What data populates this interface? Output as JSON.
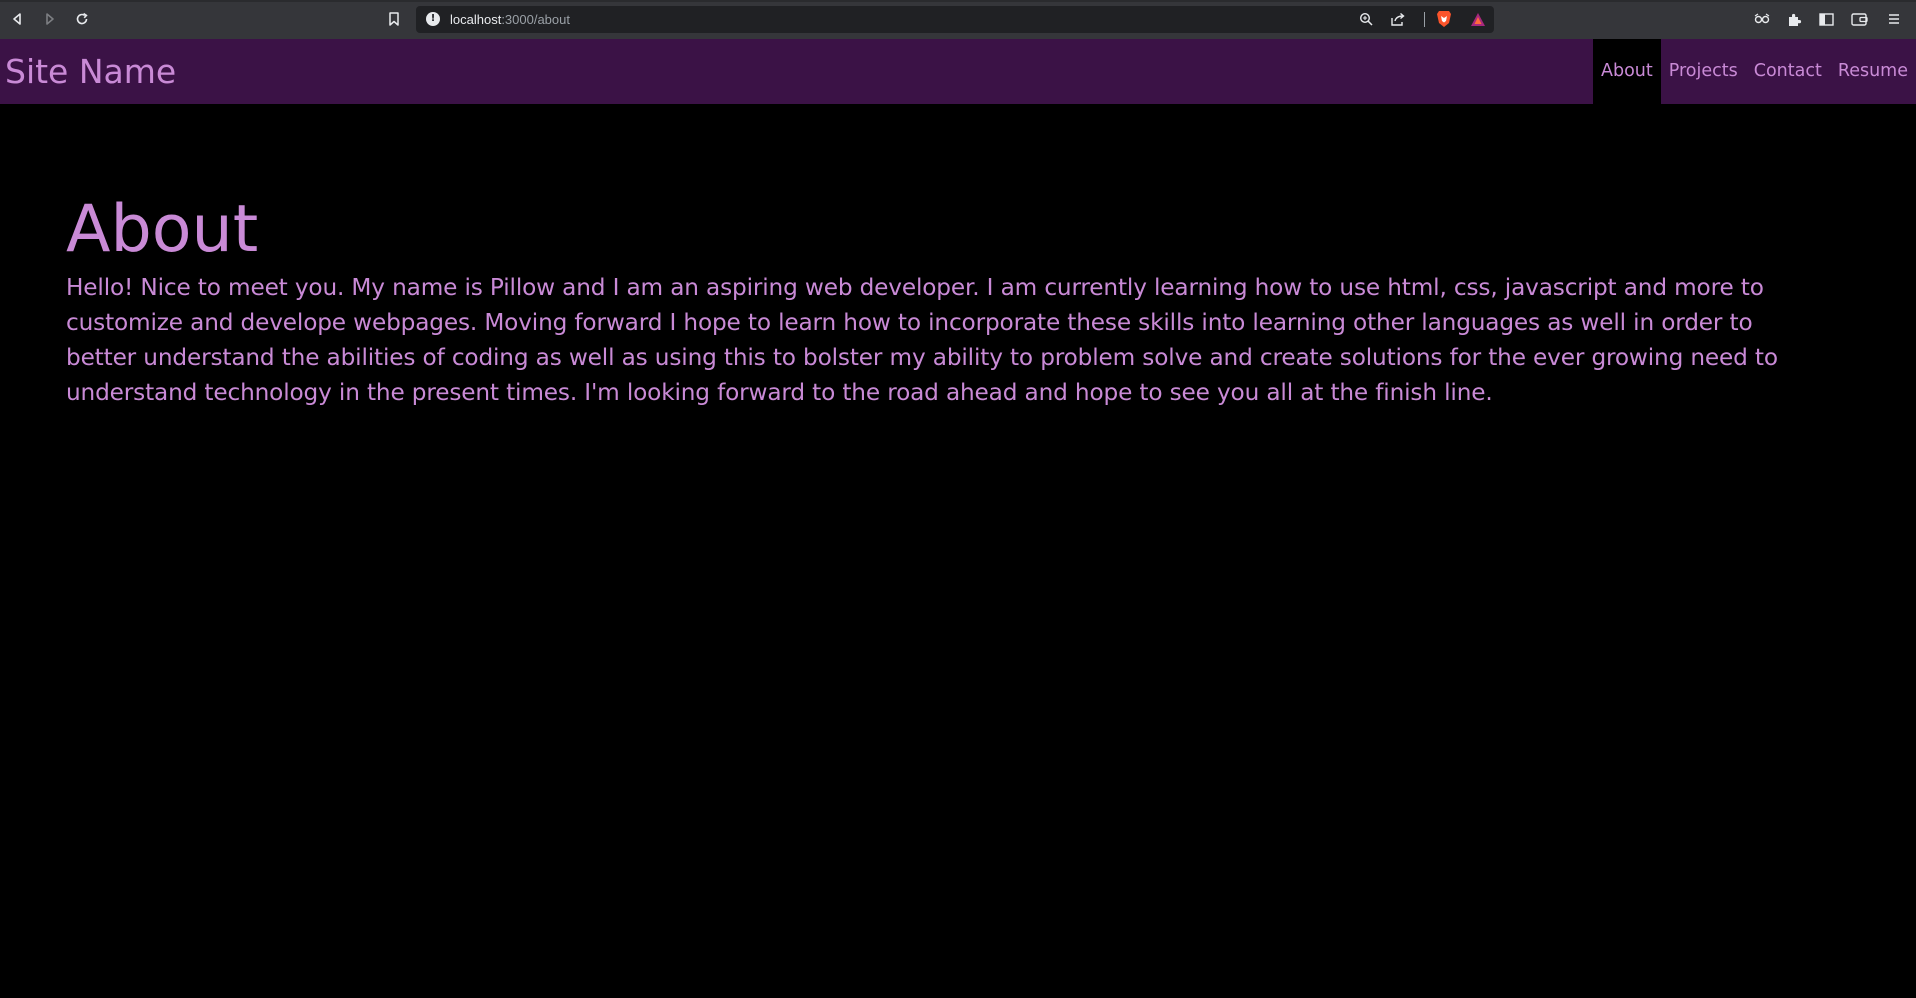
{
  "browser": {
    "url_host": "localhost",
    "url_path": ":3000/about",
    "icons": {
      "back": "back-arrow-icon",
      "forward": "forward-arrow-icon",
      "reload": "reload-icon",
      "bookmark": "bookmark-icon",
      "site_info": "info-icon",
      "zoom": "zoom-icon",
      "share": "share-icon",
      "brave_shields": "brave-lion-icon",
      "brave_rewards": "brave-rewards-triangle-icon",
      "extension_1": "glasses-icon",
      "extensions": "puzzle-piece-icon",
      "sidebar": "sidebar-icon",
      "wallet": "wallet-icon",
      "menu": "hamburger-menu-icon"
    }
  },
  "site": {
    "name": "Site Name",
    "nav": [
      {
        "label": "About",
        "active": true
      },
      {
        "label": "Projects",
        "active": false
      },
      {
        "label": "Contact",
        "active": false
      },
      {
        "label": "Resume",
        "active": false
      }
    ]
  },
  "main": {
    "title": "About",
    "paragraph": "Hello! Nice to meet you. My name is Pillow and I am an aspiring web developer. I am currently learning how to use html, css, javascript and more to customize and develope webpages. Moving forward I hope to learn how to incorporate these skills into learning other languages as well in order to better understand the abilities of coding as well as using this to bolster my ability to problem solve and create solutions for the ever growing need to understand technology in the present times. I'm looking forward to the road ahead and hope to see you all at the finish line."
  },
  "colors": {
    "header_bg": "#3b1246",
    "accent_text": "#c98ad6",
    "page_bg": "#000000",
    "active_nav_bg": "#000000"
  }
}
